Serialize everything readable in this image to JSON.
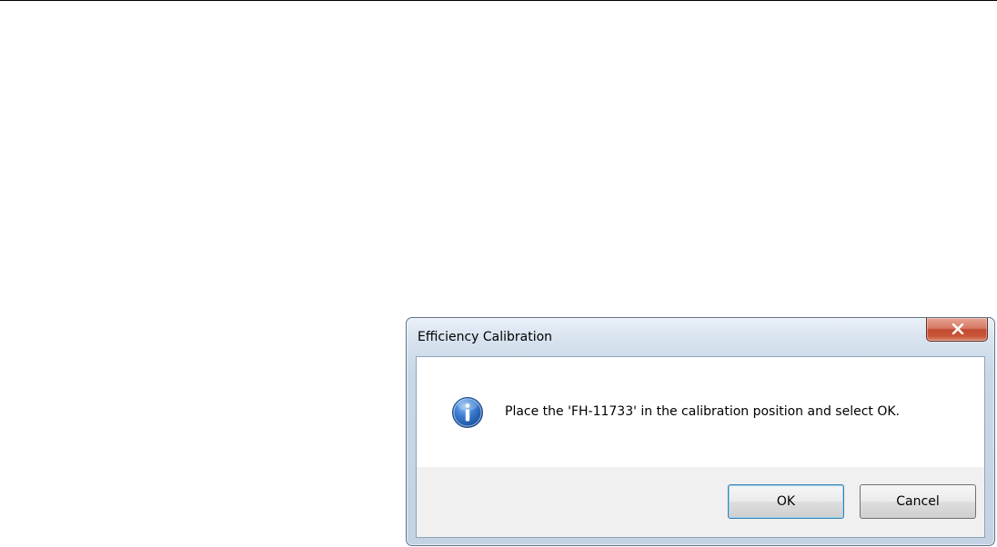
{
  "dialog": {
    "title": "Efficiency Calibration",
    "message": "Place the 'FH-11733' in the calibration position and select OK.",
    "icon": "information-icon",
    "close_icon": "close-x-icon",
    "buttons": {
      "ok_label": "OK",
      "cancel_label": "Cancel"
    }
  },
  "colors": {
    "close_button": "#c9553a",
    "info_icon": "#2a62b8",
    "default_button_border": "#3c7fb1"
  }
}
